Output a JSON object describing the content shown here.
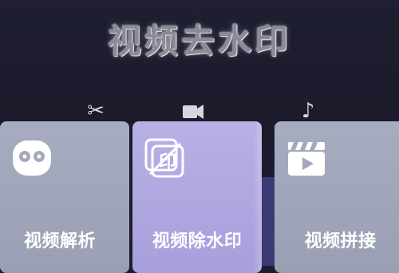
{
  "header": {
    "title": "视频去水印",
    "tab_icons": [
      "scissors-icon",
      "video-camera-icon",
      "music-note-icon"
    ]
  },
  "features": [
    {
      "label": "视频解析",
      "icon": "face-camera-icon"
    },
    {
      "label": "视频除水印",
      "icon": "remove-watermark-icon"
    },
    {
      "label": "视频拼接",
      "icon": "clapperboard-play-icon"
    }
  ],
  "colors": {
    "background": "#1e1d30",
    "card_default": "#a7acc0",
    "card_active": "#b7b1e6",
    "accent_strip": "#3a3b72"
  }
}
